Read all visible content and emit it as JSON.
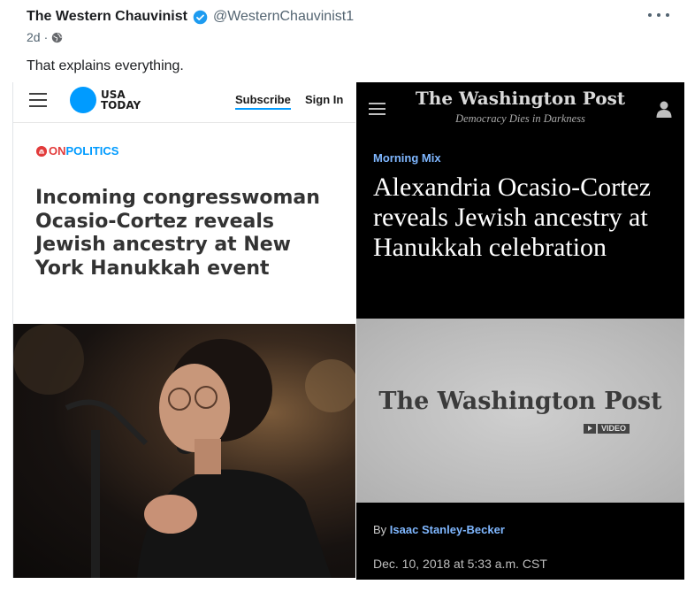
{
  "post": {
    "author_name": "The Western Chauvinist",
    "handle": "@WesternChauvinist1",
    "age": "2d",
    "separator": "·",
    "text": "That explains everything."
  },
  "usa_today": {
    "logo_line1": "USA",
    "logo_line2": "TODAY",
    "subscribe": "Subscribe",
    "sign_in": "Sign In",
    "section_on": "ON",
    "section_politics": "POLITICS",
    "headline": "Incoming congresswoman Ocasio-Cortez reveals Jewish ancestry at New York Hanukkah event"
  },
  "washington_post": {
    "masthead": "The Washington Post",
    "tagline": "Democracy Dies in Darkness",
    "kicker": "Morning Mix",
    "headline": "Alexandria Ocasio-Cortez reveals Jewish ancestry at Hanukkah celebration",
    "video_logo": "The Washington Post",
    "video_label": "VIDEO",
    "byline_prefix": "By",
    "author": "Isaac Stanley-Becker",
    "date": "Dec. 10, 2018 at 5:33 a.m. CST"
  },
  "colors": {
    "usa_blue": "#009bff",
    "wp_link_blue": "#7fb7ff",
    "verified_blue": "#1d9bf0"
  }
}
